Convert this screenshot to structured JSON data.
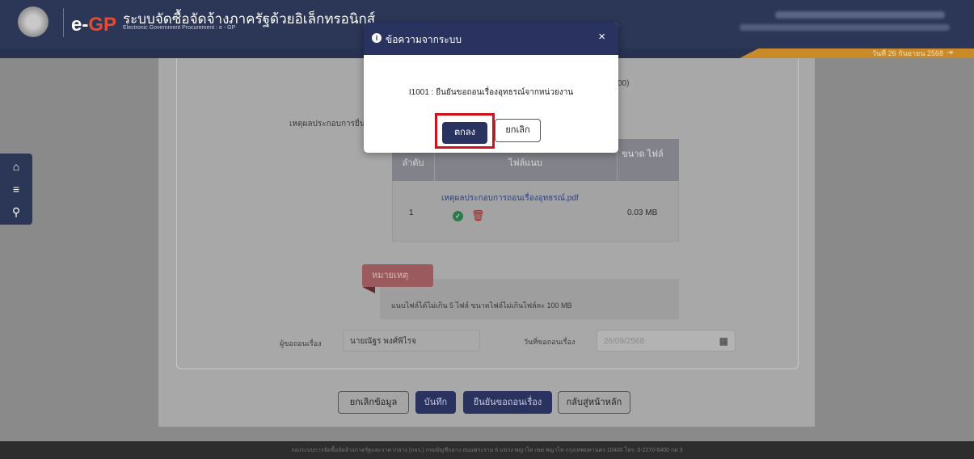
{
  "header": {
    "logo_e": "e-",
    "logo_gp": "GP",
    "system_title": "ระบบจัดซื้อจัดจ้างภาครัฐด้วยอิเล็กทรอนิกส์",
    "system_subtitle": "Electronic Government Procurement : e - GP",
    "date": "วันที่ 26 กันยายน 2568"
  },
  "sidenav": {
    "home_icon": "⌂",
    "menu_icon": "≡",
    "search_icon": "⚲"
  },
  "form": {
    "counter": "00)",
    "reason_label": "เหตุผลประกอบการยื่นถ",
    "table": {
      "headers": [
        "ลำดับ",
        "ไฟล์แนบ",
        "ขนาด ไฟล์"
      ],
      "rows": [
        {
          "index": "1",
          "file_name": "เหตุผลประกอบการถอนเรื่องอุทธรณ์.pdf",
          "size": "0.03 MB"
        }
      ]
    },
    "note_label": "หมายเหตุ",
    "note_text": "แนบไฟล์ได้ไม่เกิน 5 ไฟล์ ขนาดไฟล์ไม่เกินไฟล์ละ 100 MB",
    "requester_label": "ผู้ขอถอนเรื่อง",
    "requester_value": "นายณัฐร พงศ์พิไรจ",
    "date_label": "วันที่ขอถอนเรื่อง",
    "date_value": "26/09/2568"
  },
  "buttons": {
    "cancel_data": "ยกเลิกข้อมูล",
    "save": "บันทึก",
    "confirm_withdraw": "ยืนยันขอถอนเรื่อง",
    "back_home": "กลับสู่หน้าหลัก"
  },
  "footer": {
    "text": "กองระบบการจัดซื้อจัดจ้างภาครัฐและราคากลาง (กจร.) กรมบัญชีกลาง ถนนพระราม 6 แขวง พญาไท เขต พญาไท กรุงเทพมหานคร 10400 โทร. 0-2270-6400 กด 3"
  },
  "modal": {
    "title": "ข้อความจากระบบ",
    "message": "I1001 : ยืนยันขอถอนเรื่องอุทธรณ์จากหน่วยงาน",
    "ok_label": "ตกลง",
    "cancel_label": "ยกเลิก",
    "close_icon": "×",
    "info_icon": "i"
  },
  "colors": {
    "header_bg": "#2c3656",
    "modal_header": "#2a3260",
    "highlight": "#d0101a",
    "accent_orange": "#c98a2a"
  }
}
